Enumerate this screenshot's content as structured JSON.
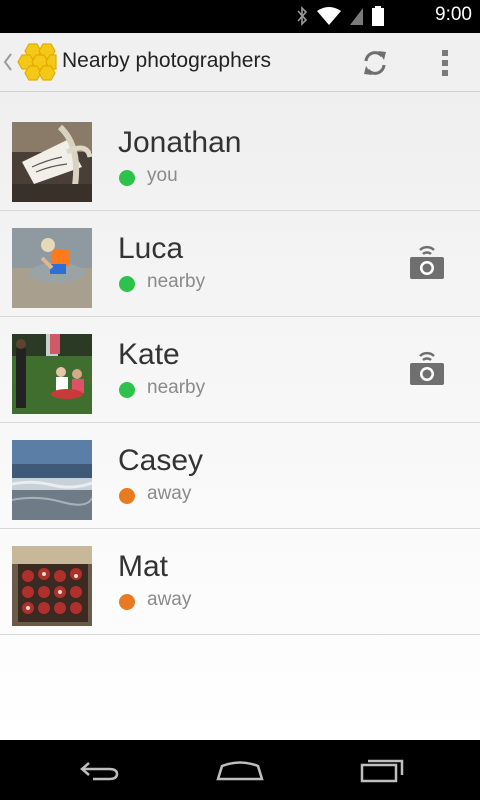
{
  "status_bar": {
    "time": "9:00"
  },
  "action_bar": {
    "title": "Nearby photographers",
    "icons": [
      "up-chevron-icon",
      "app-logo-honeycomb",
      "refresh-icon",
      "overflow-menu-icon"
    ]
  },
  "colors": {
    "online": "#2ec24a",
    "away": "#e87a22",
    "icon_gray": "#6f6f6f"
  },
  "people": [
    {
      "name": "Jonathan",
      "status": "you",
      "status_color": "online",
      "has_camera": false,
      "thumb": "gift-card-photo"
    },
    {
      "name": "Luca",
      "status": "nearby",
      "status_color": "online",
      "has_camera": true,
      "thumb": "child-in-water-photo"
    },
    {
      "name": "Kate",
      "status": "nearby",
      "status_color": "online",
      "has_camera": true,
      "thumb": "picnic-on-grass-photo"
    },
    {
      "name": "Casey",
      "status": "away",
      "status_color": "away",
      "has_camera": false,
      "thumb": "beach-waves-photo"
    },
    {
      "name": "Mat",
      "status": "away",
      "status_color": "away",
      "has_camera": false,
      "thumb": "cupcakes-photo"
    }
  ],
  "nav_bar": {
    "icons": [
      "back-icon",
      "home-icon",
      "recent-apps-icon"
    ]
  }
}
